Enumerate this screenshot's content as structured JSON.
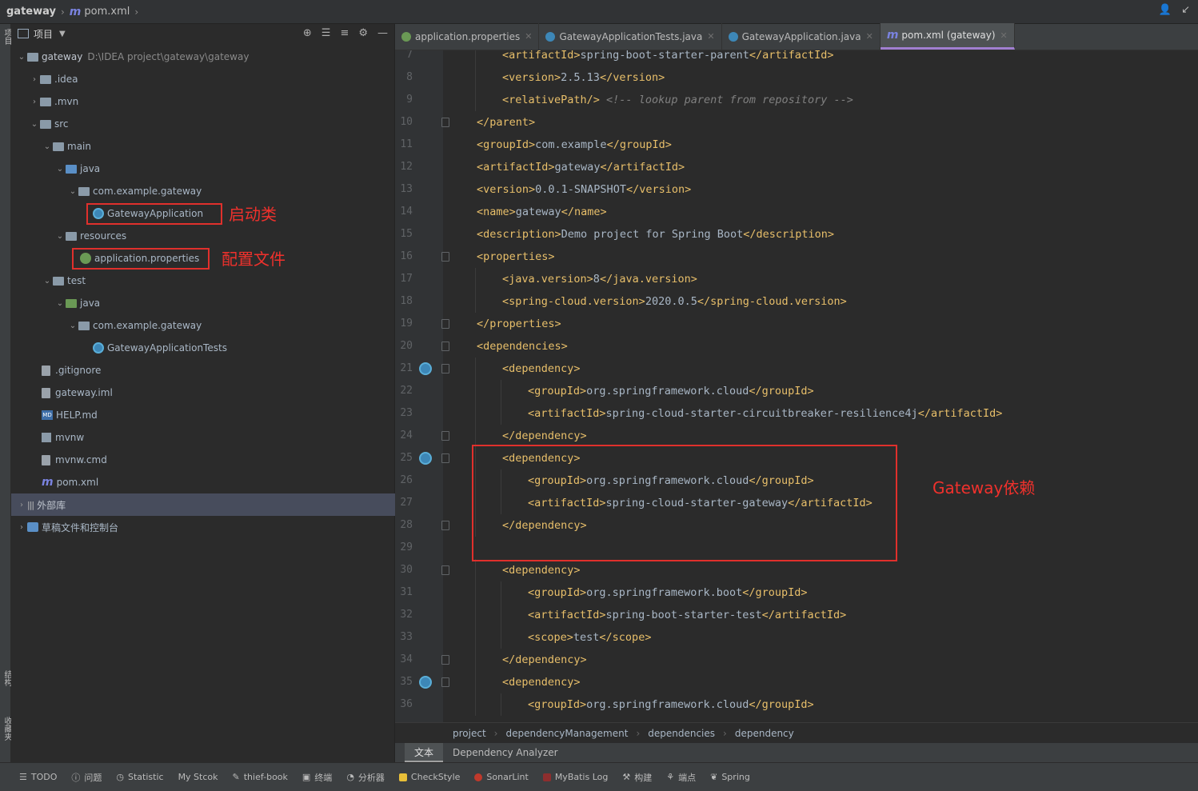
{
  "breadcrumb": {
    "project": "gateway",
    "file": "pom.xml",
    "file_icon": "m"
  },
  "project_panel": {
    "title": "项目",
    "rows": [
      {
        "label": "gateway",
        "path": "D:\\IDEA project\\gateway\\gateway"
      },
      {
        "label": ".idea"
      },
      {
        "label": ".mvn"
      },
      {
        "label": "src"
      },
      {
        "label": "main"
      },
      {
        "label": "java"
      },
      {
        "label": "com.example.gateway"
      },
      {
        "label": "GatewayApplication"
      },
      {
        "label": "resources"
      },
      {
        "label": "application.properties"
      },
      {
        "label": "test"
      },
      {
        "label": "java"
      },
      {
        "label": "com.example.gateway"
      },
      {
        "label": "GatewayApplicationTests"
      },
      {
        "label": ".gitignore"
      },
      {
        "label": "gateway.iml"
      },
      {
        "label": "HELP.md"
      },
      {
        "label": "mvnw"
      },
      {
        "label": "mvnw.cmd"
      },
      {
        "label": "pom.xml"
      },
      {
        "label": "外部库"
      },
      {
        "label": "草稿文件和控制台"
      }
    ]
  },
  "annotations": {
    "startup_class": "启动类",
    "config_file": "配置文件",
    "gateway_dependency": "Gateway依赖",
    "color": "#e0302c"
  },
  "tabs": [
    {
      "label": "application.properties",
      "active": false
    },
    {
      "label": "GatewayApplicationTests.java",
      "active": false
    },
    {
      "label": "GatewayApplication.java",
      "active": false
    },
    {
      "label": "pom.xml (gateway)",
      "active": true
    }
  ],
  "code_lines": [
    {
      "n": "7",
      "indent": 2,
      "open": "artifactId",
      "text": "spring-boot-starter-parent",
      "close": "artifactId"
    },
    {
      "n": "8",
      "indent": 2,
      "open": "version",
      "text": "2.5.13",
      "close": "version"
    },
    {
      "n": "9",
      "indent": 2,
      "selfclose": "relativePath",
      "comment": "<!-- lookup parent from repository -->"
    },
    {
      "n": "10",
      "indent": 1,
      "endtag": "parent"
    },
    {
      "n": "11",
      "indent": 1,
      "open": "groupId",
      "text": "com.example",
      "close": "groupId"
    },
    {
      "n": "12",
      "indent": 1,
      "open": "artifactId",
      "text": "gateway",
      "close": "artifactId"
    },
    {
      "n": "13",
      "indent": 1,
      "open": "version",
      "text": "0.0.1-SNAPSHOT",
      "close": "version"
    },
    {
      "n": "14",
      "indent": 1,
      "open": "name",
      "text": "gateway",
      "close": "name"
    },
    {
      "n": "15",
      "indent": 1,
      "open": "description",
      "text": "Demo project for Spring Boot",
      "close": "description"
    },
    {
      "n": "16",
      "indent": 1,
      "starttag": "properties"
    },
    {
      "n": "17",
      "indent": 2,
      "open": "java.version",
      "text": "8",
      "close": "java.version"
    },
    {
      "n": "18",
      "indent": 2,
      "open": "spring-cloud.version",
      "text": "2020.0.5",
      "close": "spring-cloud.version"
    },
    {
      "n": "19",
      "indent": 1,
      "endtag": "properties"
    },
    {
      "n": "20",
      "indent": 1,
      "starttag": "dependencies"
    },
    {
      "n": "21",
      "indent": 2,
      "starttag": "dependency"
    },
    {
      "n": "22",
      "indent": 3,
      "open": "groupId",
      "text": "org.springframework.cloud",
      "close": "groupId"
    },
    {
      "n": "23",
      "indent": 3,
      "open": "artifactId",
      "text": "spring-cloud-starter-circuitbreaker-resilience4j",
      "close": "artifactId"
    },
    {
      "n": "24",
      "indent": 2,
      "endtag": "dependency"
    },
    {
      "n": "25",
      "indent": 2,
      "starttag": "dependency"
    },
    {
      "n": "26",
      "indent": 3,
      "open": "groupId",
      "text": "org.springframework.cloud",
      "close": "groupId"
    },
    {
      "n": "27",
      "indent": 3,
      "open": "artifactId",
      "text": "spring-cloud-starter-gateway",
      "close": "artifactId"
    },
    {
      "n": "28",
      "indent": 2,
      "endtag": "dependency"
    },
    {
      "n": "29",
      "indent": 0
    },
    {
      "n": "30",
      "indent": 2,
      "starttag": "dependency"
    },
    {
      "n": "31",
      "indent": 3,
      "open": "groupId",
      "text": "org.springframework.boot",
      "close": "groupId"
    },
    {
      "n": "32",
      "indent": 3,
      "open": "artifactId",
      "text": "spring-boot-starter-test",
      "close": "artifactId"
    },
    {
      "n": "33",
      "indent": 3,
      "open": "scope",
      "text": "test",
      "close": "scope"
    },
    {
      "n": "34",
      "indent": 2,
      "endtag": "dependency"
    },
    {
      "n": "35",
      "indent": 2,
      "starttag": "dependency"
    },
    {
      "n": "36",
      "indent": 3,
      "open": "groupId",
      "text": "org.springframework.cloud",
      "close": "groupId"
    }
  ],
  "editor_breadcrumb": [
    "project",
    "dependencyManagement",
    "dependencies",
    "dependency"
  ],
  "editor_subtabs": [
    {
      "label": "文本",
      "active": true
    },
    {
      "label": "Dependency Analyzer",
      "active": false
    }
  ],
  "bottom_tools": [
    "TODO",
    "问题",
    "Statistic",
    "My Stcok",
    "thief-book",
    "终端",
    "分析器",
    "CheckStyle",
    "SonarLint",
    "MyBatis Log",
    "构建",
    "端点",
    "Spring"
  ],
  "left_strip": [
    "项目",
    "结构",
    "收藏夹"
  ],
  "colors": {
    "tag": "#e8bf6a",
    "text": "#a9b7c6",
    "comment": "#808080",
    "active_tab_underline": "#a07fd0",
    "annotation_red": "#f0312c"
  }
}
